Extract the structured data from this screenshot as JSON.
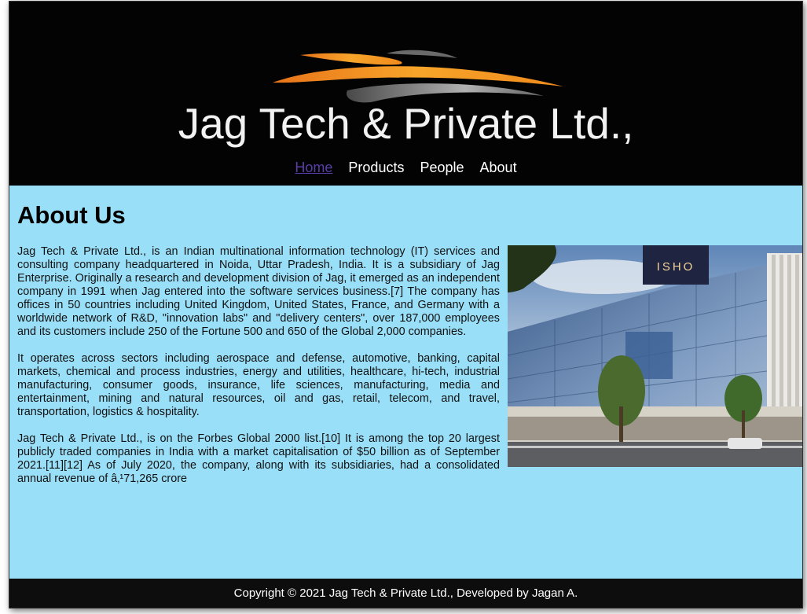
{
  "site": {
    "title": "Jag Tech & Private Ltd.,"
  },
  "nav": {
    "items": [
      {
        "label": "Home",
        "active": true
      },
      {
        "label": "Products",
        "active": false
      },
      {
        "label": "People",
        "active": false
      },
      {
        "label": "About",
        "active": false
      }
    ]
  },
  "main": {
    "heading": "About Us",
    "paragraphs": [
      "Jag Tech & Private Ltd., is an Indian multinational information technology (IT) services and consulting company headquartered in Noida, Uttar Pradesh, India. It is a subsidiary of Jag Enterprise. Originally a research and development division of Jag, it emerged as an independent company in 1991 when Jag entered into the software services business.[7] The company has offices in 50 countries including United Kingdom, United States, France, and Germany with a worldwide network of R&D, \"innovation labs\" and \"delivery centers\", over 187,000 employees and its customers include 250 of the Fortune 500 and 650 of the Global 2,000 companies.",
      "It operates across sectors including aerospace and defense, automotive, banking, capital markets, chemical and process industries, energy and utilities, healthcare, hi-tech, industrial manufacturing, consumer goods, insurance, life sciences, manufacturing, media and entertainment, mining and natural resources, oil and gas, retail, telecom, and travel, transportation, logistics & hospitality.",
      "Jag Tech & Private Ltd., is on the Forbes Global 2000 list.[10] It is among the top 20 largest publicly traded companies in India with a market capitalisation of $50 billion as of September 2021.[11][12] As of July 2020, the company, along with its subsidiaries, had a consolidated annual revenue of â‚¹71,265 crore"
    ],
    "photo_sign_text": "ISHO"
  },
  "footer": {
    "text": "Copyright © 2021 Jag Tech & Private Ltd., Developed by Jagan A."
  },
  "colors": {
    "header_bg": "#030303",
    "content_bg": "#9adff8",
    "footer_bg": "#0d0d0d",
    "nav_active": "#5a3ea8",
    "swoosh_orange": "#f39a1e"
  }
}
